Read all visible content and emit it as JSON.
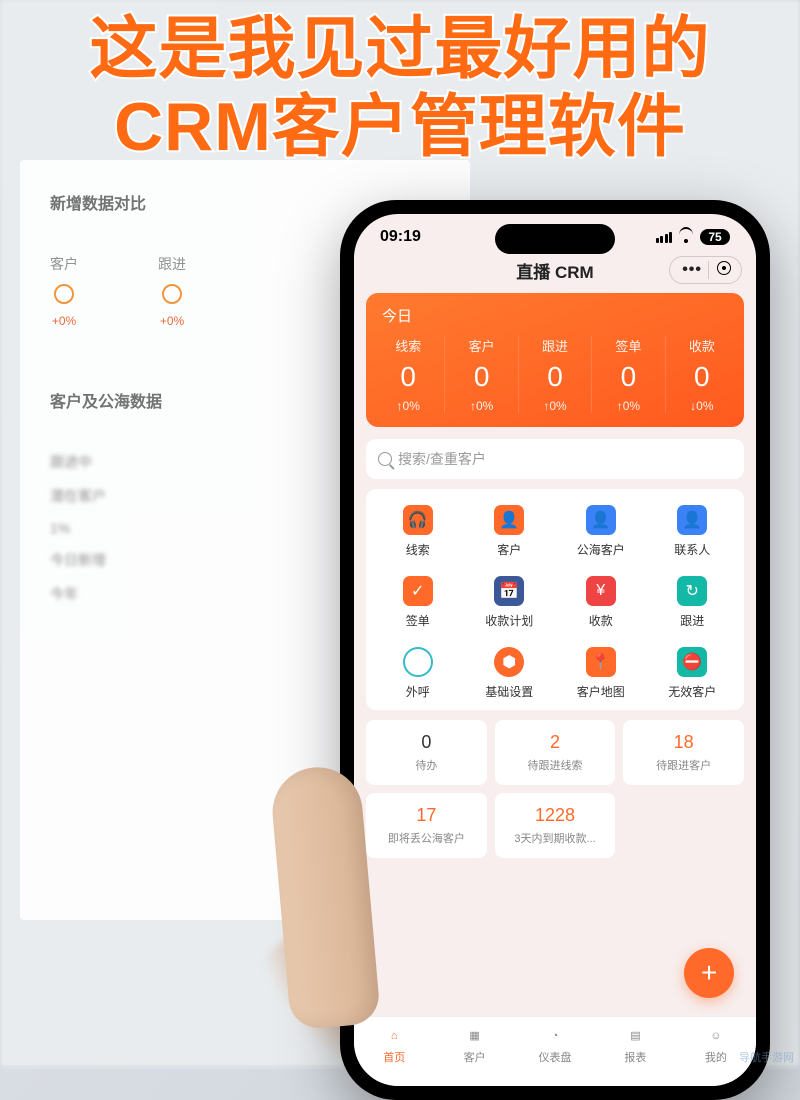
{
  "headline_line1": "这是我见过最好用的",
  "headline_line2": "CRM客户管理软件",
  "watermark": "导航手游网",
  "background": {
    "section1_title": "新增数据对比",
    "cols": [
      {
        "head": "客户",
        "pct": "+0%"
      },
      {
        "head": "跟进",
        "pct": "+0%"
      }
    ],
    "section2_title": "客户及公海数据",
    "list": [
      "跟进中",
      "潜在客户",
      "1%",
      "今日新增",
      "今年"
    ]
  },
  "status": {
    "time": "09:19",
    "battery": "75"
  },
  "header": {
    "title": "直播 CRM"
  },
  "stats": {
    "title": "今日",
    "cols": [
      {
        "label": "线索",
        "value": "0",
        "delta": "↑0%"
      },
      {
        "label": "客户",
        "value": "0",
        "delta": "↑0%"
      },
      {
        "label": "跟进",
        "value": "0",
        "delta": "↑0%"
      },
      {
        "label": "签单",
        "value": "0",
        "delta": "↑0%"
      },
      {
        "label": "收款",
        "value": "0",
        "delta": "↓0%"
      }
    ]
  },
  "search": {
    "placeholder": "搜索/查重客户"
  },
  "menu": [
    {
      "label": "线索",
      "icon": "🎧",
      "cls": "ic-orange"
    },
    {
      "label": "客户",
      "icon": "👤",
      "cls": "ic-orange"
    },
    {
      "label": "公海客户",
      "icon": "👤",
      "cls": "ic-blue"
    },
    {
      "label": "联系人",
      "icon": "👤",
      "cls": "ic-blue"
    },
    {
      "label": "签单",
      "icon": "✓",
      "cls": "ic-orange"
    },
    {
      "label": "收款计划",
      "icon": "📅",
      "cls": "ic-darkblue"
    },
    {
      "label": "收款",
      "icon": "¥",
      "cls": "ic-red"
    },
    {
      "label": "跟进",
      "icon": "↻",
      "cls": "ic-teal"
    },
    {
      "label": "外呼",
      "icon": "○",
      "cls": "ic-outline"
    },
    {
      "label": "基础设置",
      "icon": "⬢",
      "cls": "ic-hex"
    },
    {
      "label": "客户地图",
      "icon": "📍",
      "cls": "ic-orange"
    },
    {
      "label": "无效客户",
      "icon": "⛔",
      "cls": "ic-teal"
    }
  ],
  "summary": [
    {
      "value": "0",
      "label": "待办",
      "warn": false
    },
    {
      "value": "2",
      "label": "待跟进线索",
      "warn": true
    },
    {
      "value": "18",
      "label": "待跟进客户",
      "warn": true
    },
    {
      "value": "17",
      "label": "即将丢公海客户",
      "warn": true
    },
    {
      "value": "1228",
      "label": "3天内到期收款...",
      "warn": true
    }
  ],
  "fab": {
    "label": "+"
  },
  "tabs": [
    {
      "label": "首页",
      "icon": "⌂",
      "active": true
    },
    {
      "label": "客户",
      "icon": "▦",
      "active": false
    },
    {
      "label": "仪表盘",
      "icon": "◔",
      "active": false
    },
    {
      "label": "报表",
      "icon": "▤",
      "active": false
    },
    {
      "label": "我的",
      "icon": "☺",
      "active": false
    }
  ]
}
